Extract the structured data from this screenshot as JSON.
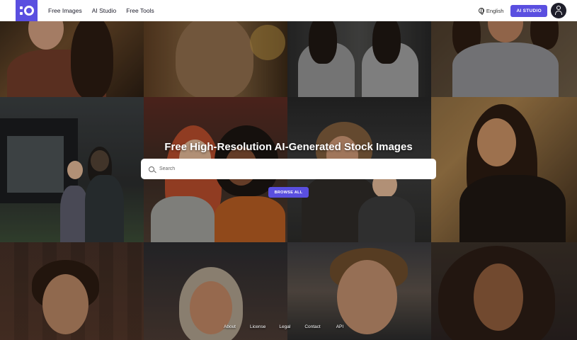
{
  "header": {
    "logo_name": "logo-icon",
    "nav": [
      "Free Images",
      "AI Studio",
      "Free Tools"
    ],
    "language": "English",
    "ai_studio_button": "AI STUDIO"
  },
  "hero": {
    "title": "Free High-Resolution AI-Generated Stock Images",
    "search_placeholder": "Search",
    "browse_button": "BROWSE ALL"
  },
  "footer": {
    "links": [
      "About",
      "License",
      "Legal",
      "Contact",
      "API"
    ]
  },
  "colors": {
    "accent": "#5a4fe0"
  }
}
